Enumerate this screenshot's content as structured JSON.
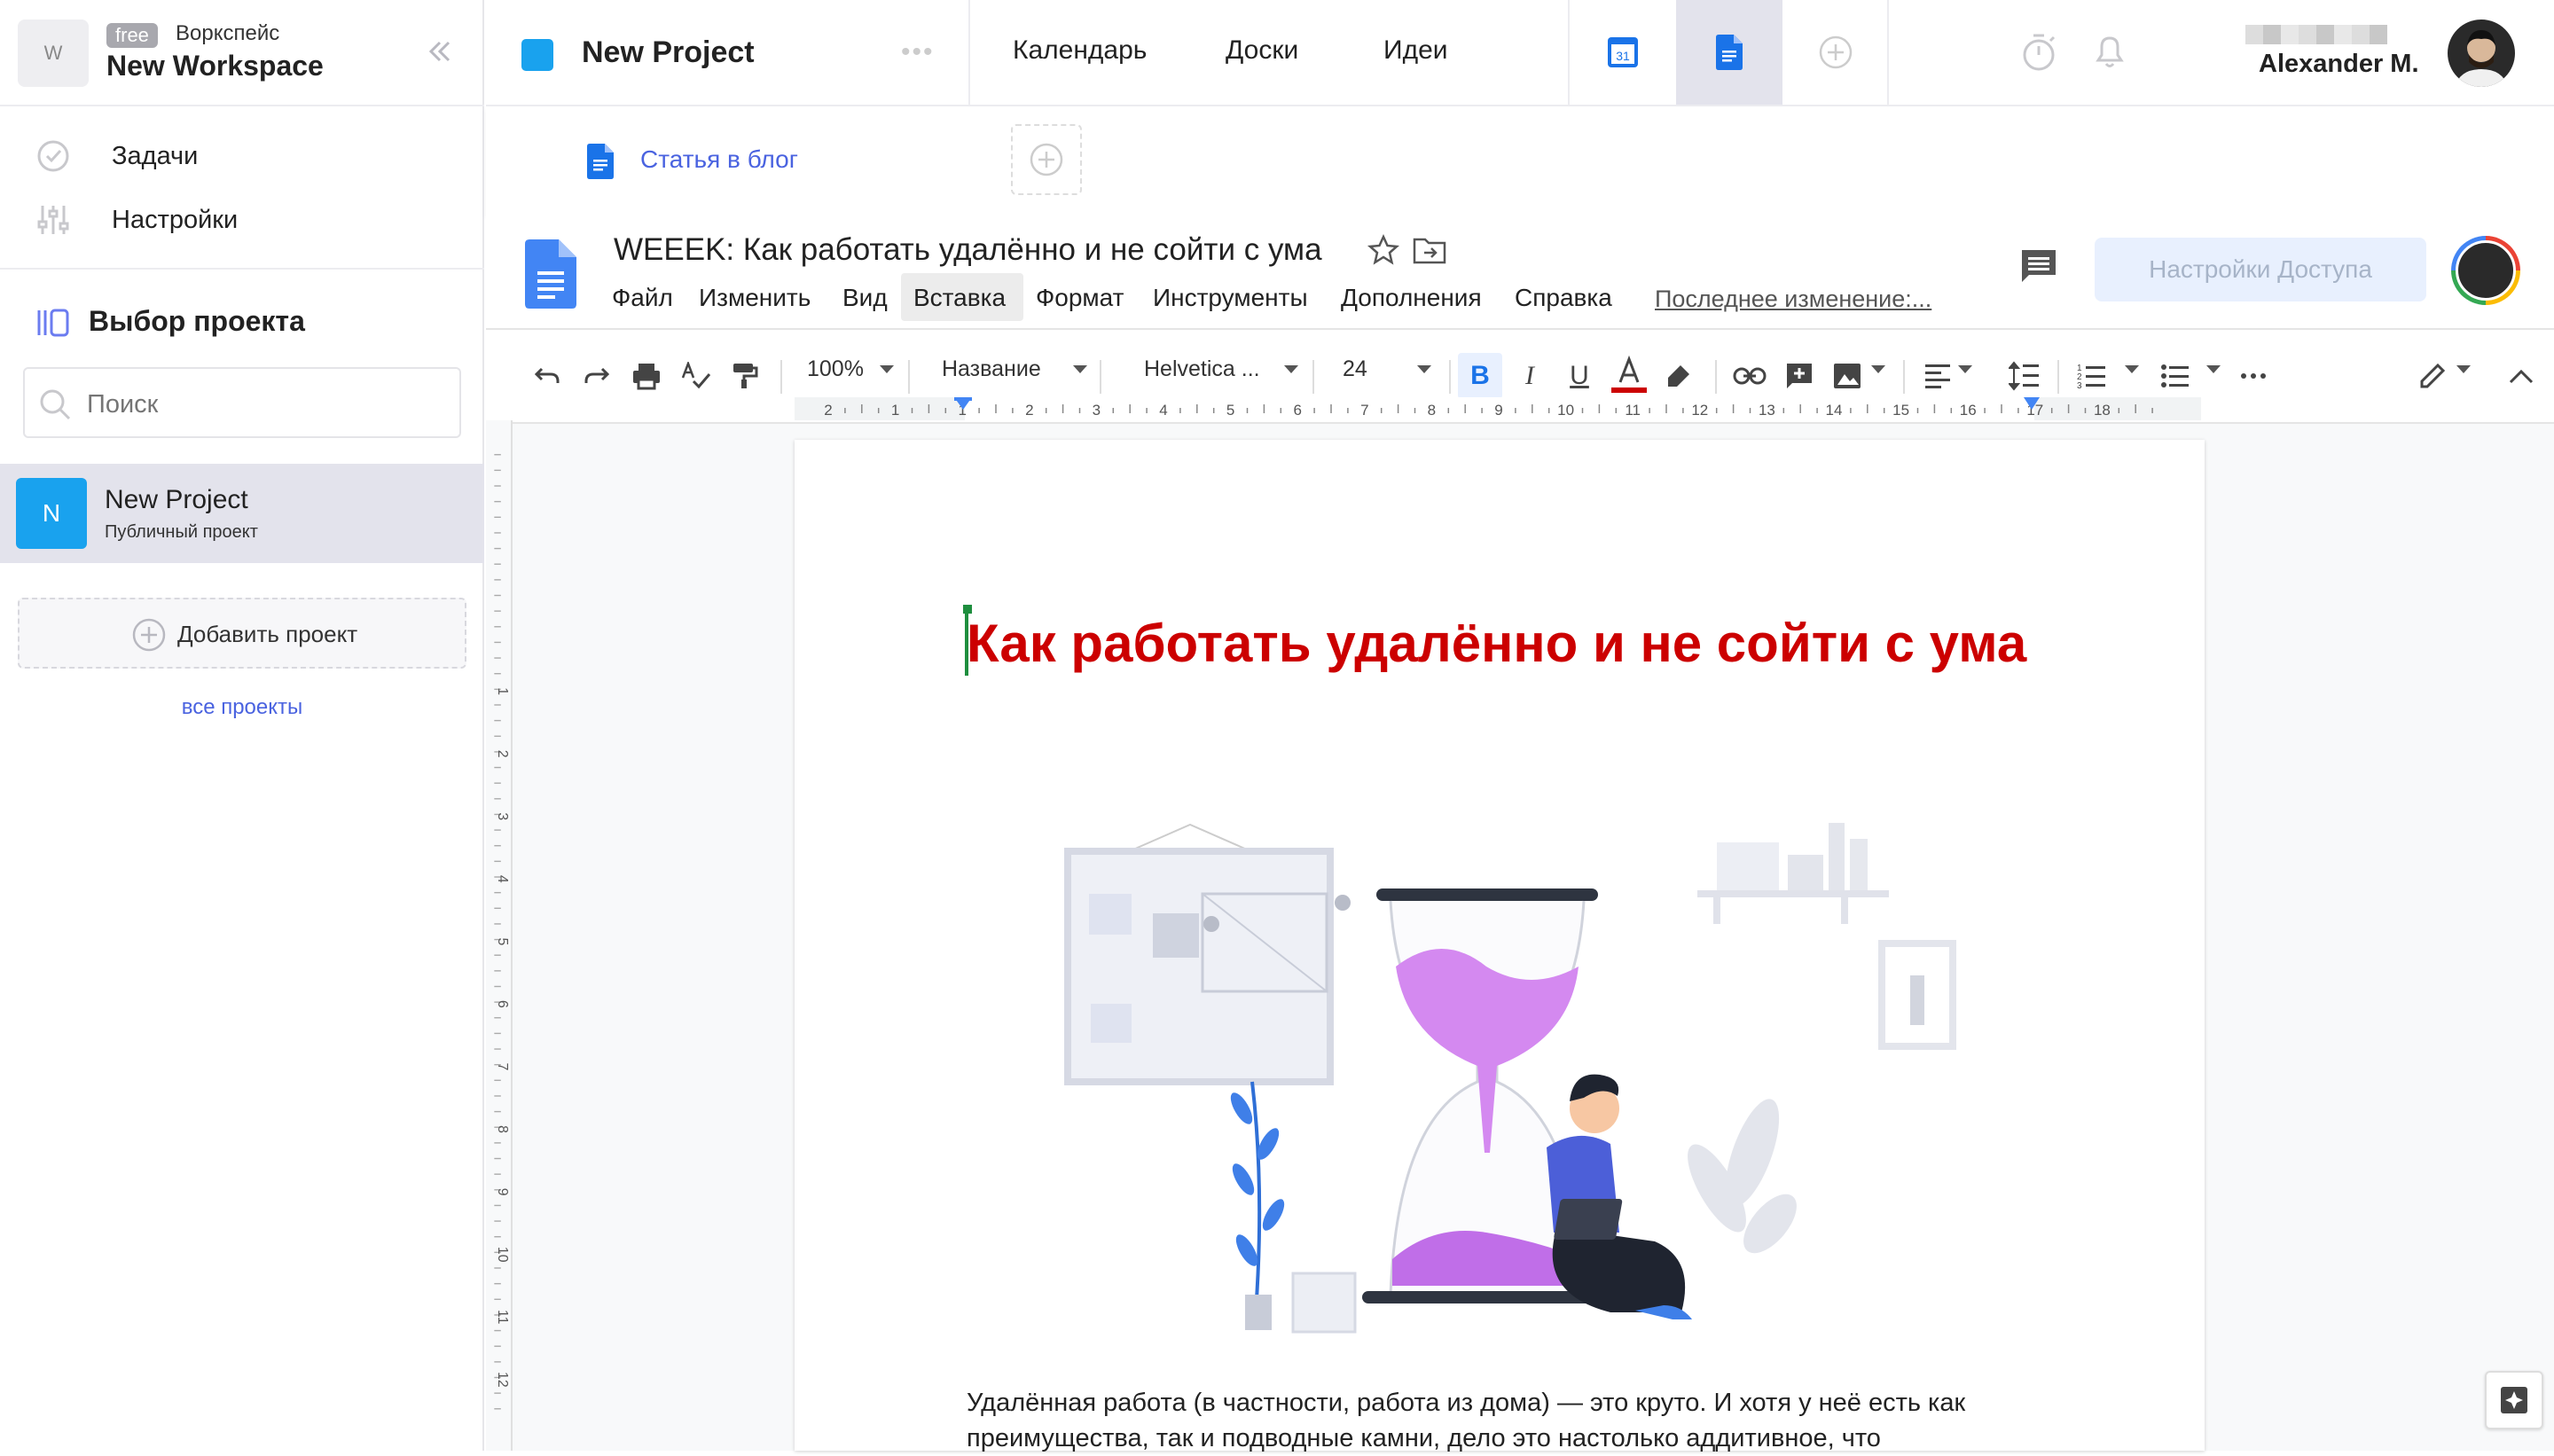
{
  "workspace": {
    "avatar": "W",
    "badge": "free",
    "type": "Воркспейс",
    "name": "New Workspace"
  },
  "sidebar": {
    "items": [
      {
        "label": "Задачи",
        "icon": "check-circle-icon"
      },
      {
        "label": "Настройки",
        "icon": "sliders-icon"
      }
    ],
    "select_title": "Выбор проекта",
    "search_placeholder": "Поиск",
    "project": {
      "avatar": "N",
      "name": "New Project",
      "subtitle": "Публичный проект"
    },
    "add_project": "Добавить проект",
    "all_projects": "все проекты"
  },
  "topbar": {
    "project_title": "New Project",
    "nav": [
      "Календарь",
      "Доски",
      "Идеи"
    ],
    "calendar_day": "31",
    "user_name": "Alexander M."
  },
  "doc_tab": {
    "label": "Статья в блог"
  },
  "gdocs": {
    "title": "WEEEK: Как работать удалённо и не сойти с ума",
    "menu": [
      "Файл",
      "Изменить",
      "Вид",
      "Вставка",
      "Формат",
      "Инструменты",
      "Дополнения",
      "Справка"
    ],
    "last_edit": "Последнее изменение:...",
    "share": "Настройки Доступа"
  },
  "toolbar": {
    "zoom": "100%",
    "style": "Название",
    "font": "Helvetica ...",
    "size": "24"
  },
  "ruler": {
    "horizontal": [
      "2",
      "1",
      "1",
      "2",
      "3",
      "4",
      "5",
      "6",
      "7",
      "8",
      "9",
      "10",
      "11",
      "12",
      "13",
      "14",
      "15",
      "16",
      "17",
      "18"
    ],
    "vertical": [
      "1",
      "2",
      "3",
      "4",
      "5",
      "6",
      "7",
      "8",
      "9",
      "10",
      "11",
      "12"
    ]
  },
  "document": {
    "heading": "Как работать удалённо и не сойти с ума",
    "paragraph": "Удалённая работа (в частности, работа из дома) — это круто. И хотя у неё есть как преимущества, так и подводные камни, дело это настолько аддитивное, что"
  },
  "colors": {
    "accent": "#19a2ee",
    "link": "#4a63e0",
    "heading": "#cc0000",
    "gdocs_blue": "#1a73e8"
  }
}
